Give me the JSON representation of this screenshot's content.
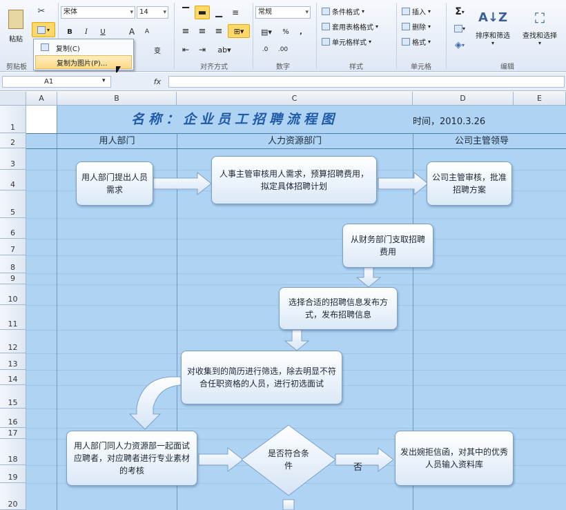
{
  "ribbon": {
    "clipboard": {
      "paste": "粘贴",
      "group_label": "剪贴板"
    },
    "font": {
      "name": "宋体",
      "size": "14",
      "bold": "B",
      "italic": "I",
      "underline": "U",
      "grow": "A",
      "shrink": "A",
      "phonetic": "变"
    },
    "alignment": {
      "group_label": "对齐方式"
    },
    "number": {
      "format": "常规",
      "percent": "%",
      "comma": ",",
      "group_label": "数字"
    },
    "styles": {
      "conditional": "条件格式",
      "table": "套用表格格式",
      "cell": "单元格样式",
      "group_label": "样式"
    },
    "cells": {
      "insert": "插入",
      "delete": "删除",
      "format": "格式",
      "group_label": "单元格"
    },
    "editing": {
      "sum": "Σ",
      "sort": "排序和筛选",
      "find": "查找和选择",
      "group_label": "编辑"
    }
  },
  "context_menu": {
    "copy": "复制(C)",
    "copy_as_picture": "复制为图片(P)..."
  },
  "formula_bar": {
    "name_box": "A1",
    "fx": "fx"
  },
  "columns": [
    "A",
    "B",
    "C",
    "D",
    "E"
  ],
  "rows": [
    "1",
    "2",
    "3",
    "4",
    "5",
    "6",
    "7",
    "8",
    "9",
    "10",
    "11",
    "12",
    "13",
    "14",
    "15",
    "16",
    "17",
    "18",
    "19",
    "20"
  ],
  "sheet": {
    "title": "名称：企业员工招聘流程图",
    "date": "时间，2010.3.26",
    "lanes": [
      "用人部门",
      "人力资源部门",
      "公司主管领导"
    ]
  },
  "flow": {
    "b1": "用人部门提出人员需求",
    "b2": "人事主管审核用人需求，预算招聘费用，拟定具体招聘计划",
    "b3": "公司主管审核，批准招聘方案",
    "b4": "从财务部门支取招聘费用",
    "b5": "选择合适的招聘信息发布方式，发布招聘信息",
    "b6": "对收集到的简历进行筛选，除去明显不符合任职资格的人员，进行初选面试",
    "b7": "用人部门同人力资源部一起面试应聘者，对应聘者进行专业素材的考核",
    "decision": "是否符合条件",
    "no": "否",
    "b8": "发出婉拒信函，对其中的优秀人员输入资料库"
  }
}
